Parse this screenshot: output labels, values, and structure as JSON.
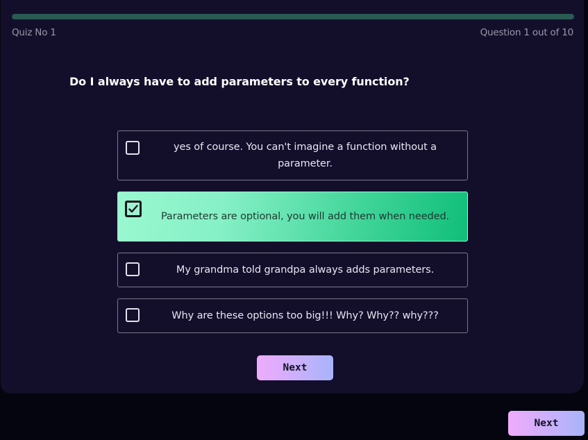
{
  "quiz": {
    "title": "Quiz No 1",
    "progress_text": "Question 1 out of 10",
    "progress_fraction": 1.0
  },
  "question": {
    "text": "Do I always have to add parameters to every function?"
  },
  "options": [
    {
      "text": "yes of course. You can't imagine a function without a parameter.",
      "checked": false
    },
    {
      "text": "Parameters are optional, you will add them when needed.",
      "checked": true
    },
    {
      "text": "My grandma told grandpa always adds parameters.",
      "checked": false
    },
    {
      "text": "Why are these options too big!!! Why? Why?? why???",
      "checked": false
    }
  ],
  "buttons": {
    "card_next_label": "Next",
    "page_next_label": "Next"
  },
  "colors": {
    "background": "#04050f",
    "card": "#130f2b",
    "selected_gradient_start": "#9af8d0",
    "selected_gradient_end": "#10be7a",
    "button_gradient_start": "#f0abfc",
    "button_gradient_end": "#a7b4fa"
  },
  "icons": {
    "checked": "check-icon"
  }
}
